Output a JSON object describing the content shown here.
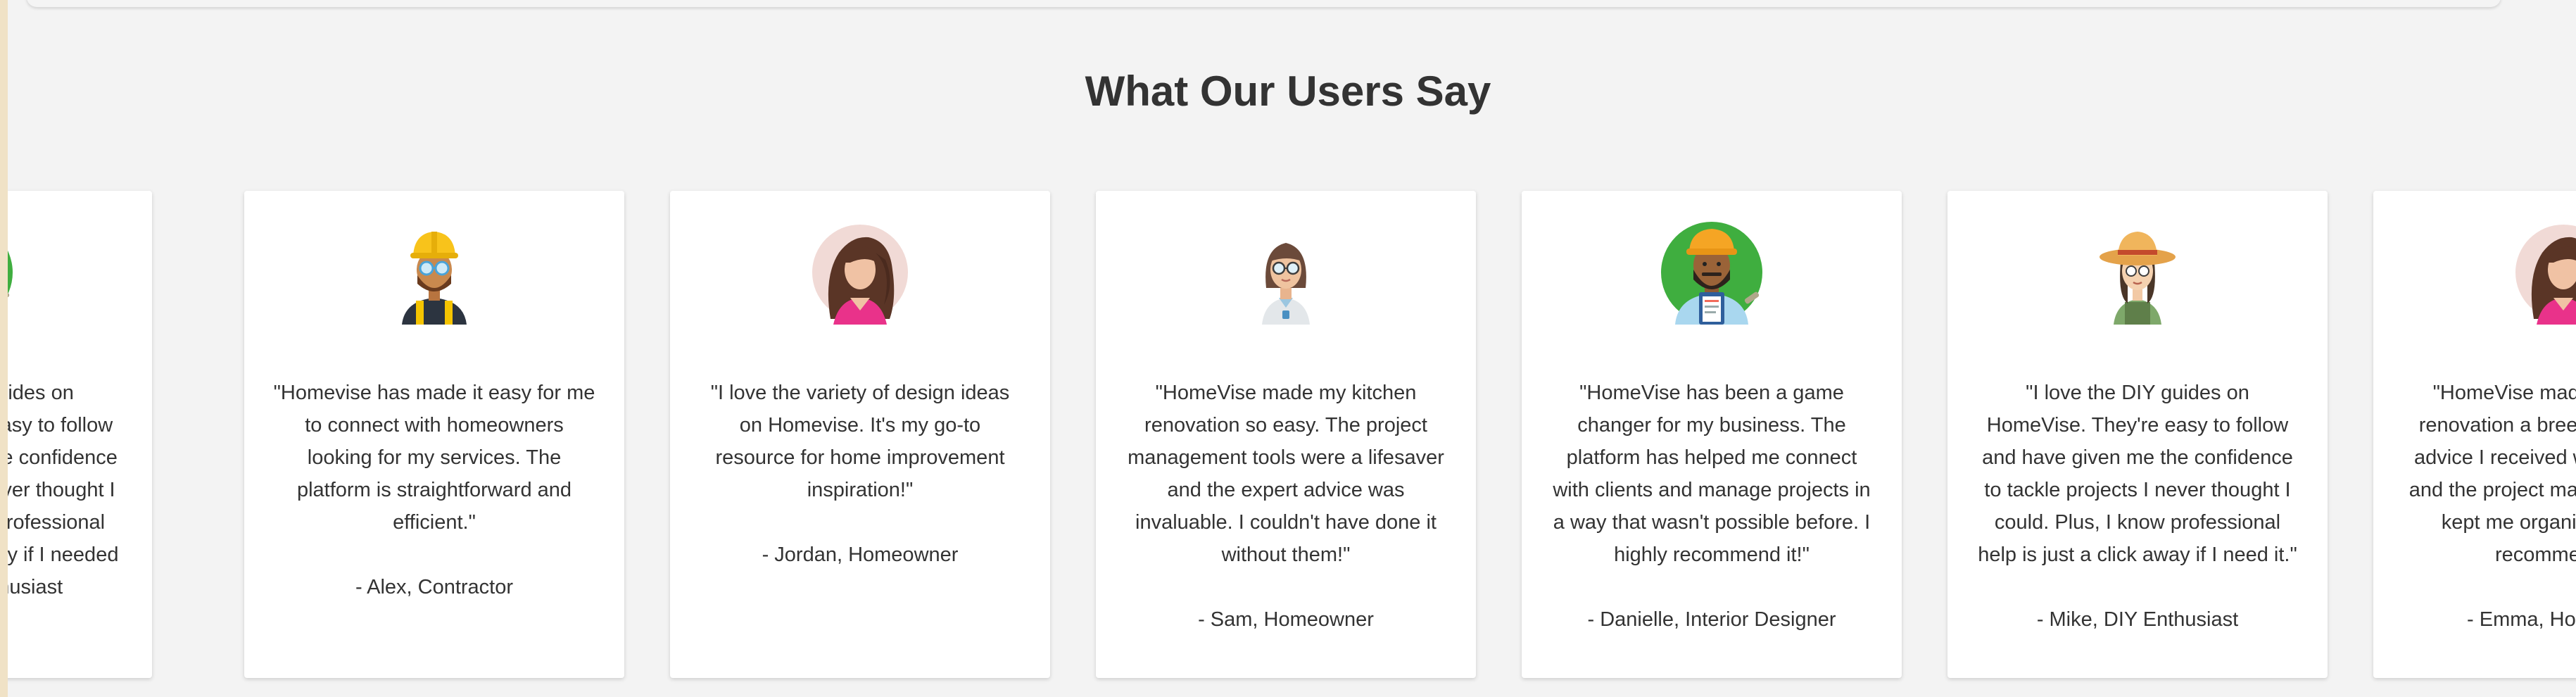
{
  "section": {
    "title": "What Our Users Say"
  },
  "testimonials": [
    {
      "quote": "\"I love the DIY guides on HomeVise. They're easy to follow and have given me the confidence to tackle projects I never thought I could. Plus, I know professional help is just a click away if I needed it.\"",
      "author": "- Mike, DIY Enthusiast",
      "avatar": "contractor-clipboard-avatar"
    },
    {
      "quote": "\"Homevise has made it easy for me to connect with homeowners looking for my services. The platform is straightforward and efficient.\"",
      "author": "- Alex, Contractor",
      "avatar": "construction-worker-avatar"
    },
    {
      "quote": "\"I love the variety of design ideas on Homevise. It's my go-to resource for home improvement inspiration!\"",
      "author": "- Jordan, Homeowner",
      "avatar": "woman-long-hair-avatar"
    },
    {
      "quote": "\"HomeVise made my kitchen renovation so easy. The project management tools were a lifesaver and the expert advice was invaluable. I couldn't have done it without them!\"",
      "author": "- Sam, Homeowner",
      "avatar": "woman-glasses-avatar"
    },
    {
      "quote": "\"HomeVise has been a game changer for my business. The platform has helped me connect with clients and manage projects in a way that wasn't possible before. I highly recommend it!\"",
      "author": "- Danielle, Interior Designer",
      "avatar": "contractor-clipboard-avatar"
    },
    {
      "quote": "\"I love the DIY guides on HomeVise. They're easy to follow and have given me the confidence to tackle projects I never thought I could. Plus, I know professional help is just a click away if I need it.\"",
      "author": "- Mike, DIY Enthusiast",
      "avatar": "farmer-straw-hat-avatar"
    },
    {
      "quote": "\"HomeVise made my kitchen renovation a breeze. The expert advice I received was invaluable, and the project management tools kept me organized. I highly recommend it!\"",
      "author": "- Emma, Homeowner",
      "avatar": "woman-long-hair-avatar"
    }
  ]
}
